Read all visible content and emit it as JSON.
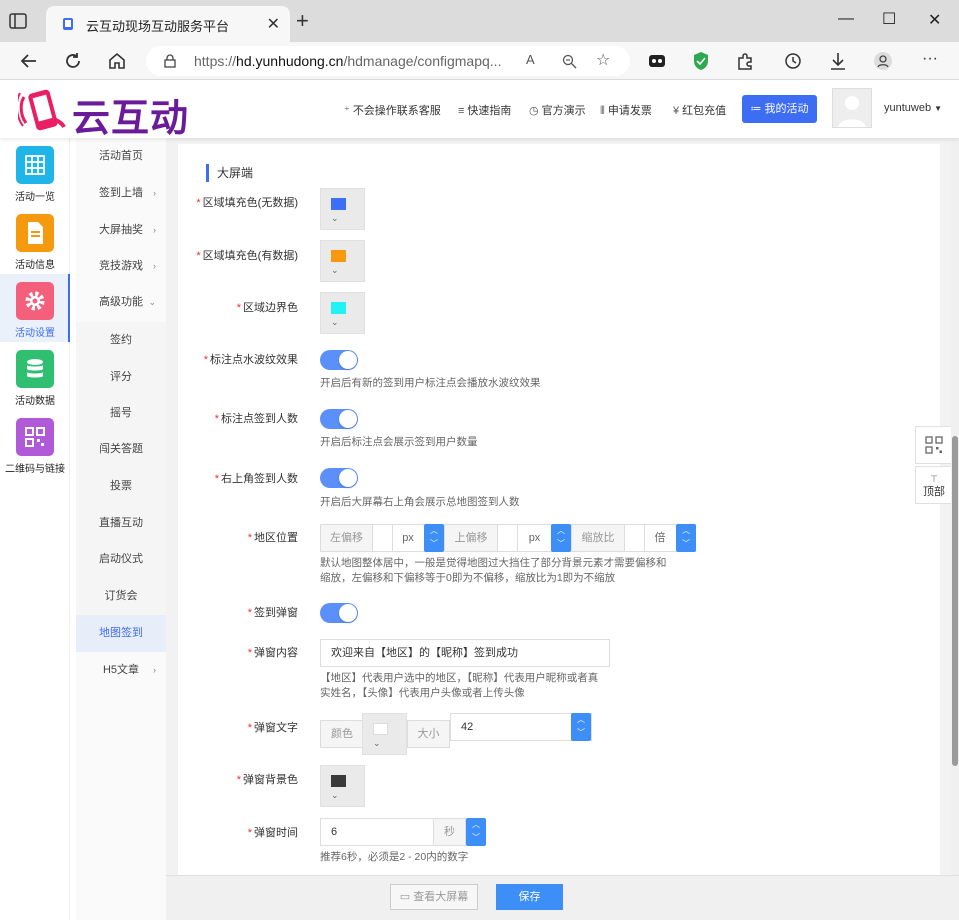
{
  "browser": {
    "tab_title": "云互动现场互动服务平台",
    "url_prefix": "https://",
    "url_host": "hd.yunhudong.cn",
    "url_path": "/hdmanage/configmapq..."
  },
  "header": {
    "logo_text": "云互动",
    "nav": [
      {
        "label": "不会操作联系客服",
        "icon": "user-plus-icon"
      },
      {
        "label": "快速指南",
        "icon": "list-icon"
      },
      {
        "label": "官方演示",
        "icon": "play-circle-icon"
      },
      {
        "label": "申请发票",
        "icon": "barcode-icon"
      },
      {
        "label": "红包充值",
        "icon": "yen-icon"
      }
    ],
    "my_activity": "我的活动",
    "username": "yuntuweb"
  },
  "iconbar": [
    {
      "label": "活动一览",
      "color": "#1fb5e8",
      "icon": "grid-icon"
    },
    {
      "label": "活动信息",
      "color": "#f59a0f",
      "icon": "document-icon"
    },
    {
      "label": "活动设置",
      "color": "#f4607c",
      "icon": "gear-icon",
      "active": true
    },
    {
      "label": "活动数据",
      "color": "#2fbf71",
      "icon": "database-icon"
    },
    {
      "label": "二维码与链接",
      "color": "#b05ad9",
      "icon": "qrcode-icon"
    }
  ],
  "submenu": [
    {
      "label": "活动首页",
      "chevron": ""
    },
    {
      "label": "签到上墙",
      "chevron": "›"
    },
    {
      "label": "大屏抽奖",
      "chevron": "›"
    },
    {
      "label": "竞技游戏",
      "chevron": "›"
    },
    {
      "label": "高级功能",
      "chevron": "⌄"
    },
    {
      "label": "签约",
      "chevron": "",
      "sub": true
    },
    {
      "label": "评分",
      "chevron": "",
      "sub": true
    },
    {
      "label": "摇号",
      "chevron": "",
      "sub": true
    },
    {
      "label": "闯关答题",
      "chevron": "",
      "sub": true
    },
    {
      "label": "投票",
      "chevron": "",
      "sub": true
    },
    {
      "label": "直播互动",
      "chevron": "",
      "sub": true
    },
    {
      "label": "启动仪式",
      "chevron": "",
      "sub": true
    },
    {
      "label": "订货会",
      "chevron": "",
      "sub": true
    },
    {
      "label": "地图签到",
      "chevron": "",
      "sub": true,
      "active": true
    },
    {
      "label": "H5文章",
      "chevron": "›"
    }
  ],
  "form": {
    "section_title": "大屏端",
    "fill_no_data": {
      "label": "区域填充色(无数据)",
      "color": "#3b6ff5"
    },
    "fill_has_data": {
      "label": "区域填充色(有数据)",
      "color": "#f7980f"
    },
    "border_color": {
      "label": "区域边界色",
      "color": "#22f2f5"
    },
    "ripple": {
      "label": "标注点水波纹效果",
      "hint": "开启后有新的签到用户标注点会播放水波纹效果"
    },
    "point_count": {
      "label": "标注点签到人数",
      "hint": "开启后标注点会展示签到用户数量"
    },
    "corner_count": {
      "label": "右上角签到人数",
      "hint": "开启后大屏幕右上角会展示总地图签到人数"
    },
    "position": {
      "label": "地区位置",
      "left_addon": "左偏移",
      "unit1": "px",
      "top_addon": "上偏移",
      "unit2": "px",
      "scale_addon": "缩放比",
      "unit3": "倍",
      "hint_line1": "默认地图整体居中，一般是觉得地图过大挡住了部分背景元素才需要偏移和",
      "hint_line2": "缩放，左偏移和下偏移等于0即为不偏移，缩放比为1即为不缩放"
    },
    "popup": {
      "label": "签到弹窗"
    },
    "popup_content": {
      "label": "弹窗内容",
      "value": "欢迎来自【地区】的【昵称】签到成功",
      "hint_line1": "【地区】代表用户选中的地区，【昵称】代表用户昵称或者真",
      "hint_line2": "实姓名，【头像】代表用户头像或者上传头像"
    },
    "popup_text": {
      "label": "弹窗文字",
      "color_addon": "颜色",
      "size_addon": "大小",
      "size_value": "42",
      "color": "#ffffff"
    },
    "popup_bg": {
      "label": "弹窗背景色",
      "color": "#3a3a3a"
    },
    "popup_time": {
      "label": "弹窗时间",
      "value": "6",
      "unit": "秒",
      "hint": "推荐6秒，必须是2 - 20内的数字"
    }
  },
  "float": {
    "top_label": "顶部"
  },
  "footer": {
    "preview": "查看大屏幕",
    "save": "保存"
  }
}
